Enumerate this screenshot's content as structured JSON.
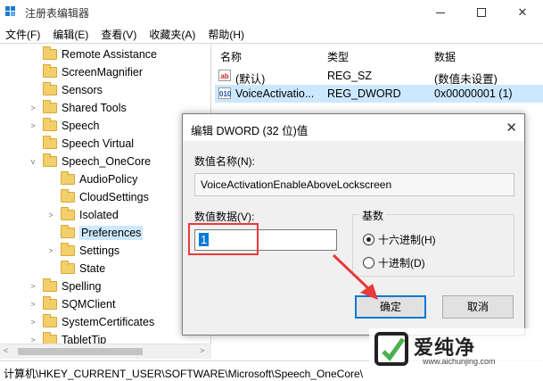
{
  "window": {
    "title": "注册表编辑器",
    "minimize": "—",
    "maximize": "☐",
    "close": "✕"
  },
  "menu": [
    "文件(F)",
    "编辑(E)",
    "查看(V)",
    "收藏夹(A)",
    "帮助(H)"
  ],
  "tree": {
    "items": [
      {
        "label": "Remote Assistance",
        "expander": "",
        "selected": false
      },
      {
        "label": "ScreenMagnifier",
        "expander": "",
        "selected": false
      },
      {
        "label": "Sensors",
        "expander": "",
        "selected": false
      },
      {
        "label": "Shared Tools",
        "expander": ">",
        "selected": false
      },
      {
        "label": "Speech",
        "expander": ">",
        "selected": false
      },
      {
        "label": "Speech Virtual",
        "expander": "",
        "selected": false
      },
      {
        "label": "Speech_OneCore",
        "expander": "v",
        "selected": false
      },
      {
        "label": "AudioPolicy",
        "expander": "",
        "selected": false
      },
      {
        "label": "CloudSettings",
        "expander": "",
        "selected": false
      },
      {
        "label": "Isolated",
        "expander": ">",
        "selected": false
      },
      {
        "label": "Preferences",
        "expander": "",
        "selected": true
      },
      {
        "label": "Settings",
        "expander": ">",
        "selected": false
      },
      {
        "label": "State",
        "expander": "",
        "selected": false
      },
      {
        "label": "Spelling",
        "expander": ">",
        "selected": false
      },
      {
        "label": "SQMClient",
        "expander": ">",
        "selected": false
      },
      {
        "label": "SystemCertificates",
        "expander": ">",
        "selected": false
      },
      {
        "label": "TabletTip",
        "expander": ">",
        "selected": false
      }
    ]
  },
  "list": {
    "headers": {
      "name": "名称",
      "type": "类型",
      "data": "数据"
    },
    "rows": [
      {
        "icon": "ab",
        "name": "(默认)",
        "type": "REG_SZ",
        "data": "(数值未设置)"
      },
      {
        "icon": "010",
        "name": "VoiceActivatio...",
        "type": "REG_DWORD",
        "data": "0x00000001 (1)"
      }
    ]
  },
  "statusbar": {
    "path": "计算机\\HKEY_CURRENT_USER\\SOFTWARE\\Microsoft\\Speech_OneCore\\"
  },
  "dialog": {
    "title": "编辑 DWORD (32 位)值",
    "close": "✕",
    "name_label": "数值名称(N):",
    "name_value": "VoiceActivationEnableAboveLockscreen",
    "data_label": "数值数据(V):",
    "data_value": "1",
    "base_label": "基数",
    "hex_label": "十六进制(H)",
    "dec_label": "十进制(D)",
    "hex_selected": true,
    "ok_label": "确定",
    "cancel_label": "取消"
  },
  "watermark": {
    "text": "爱纯净",
    "url": "www.aichunjing.com"
  },
  "colors": {
    "selection": "#cce8ff",
    "highlight_box": "#e83a3a",
    "default_button": "#0078d7"
  }
}
